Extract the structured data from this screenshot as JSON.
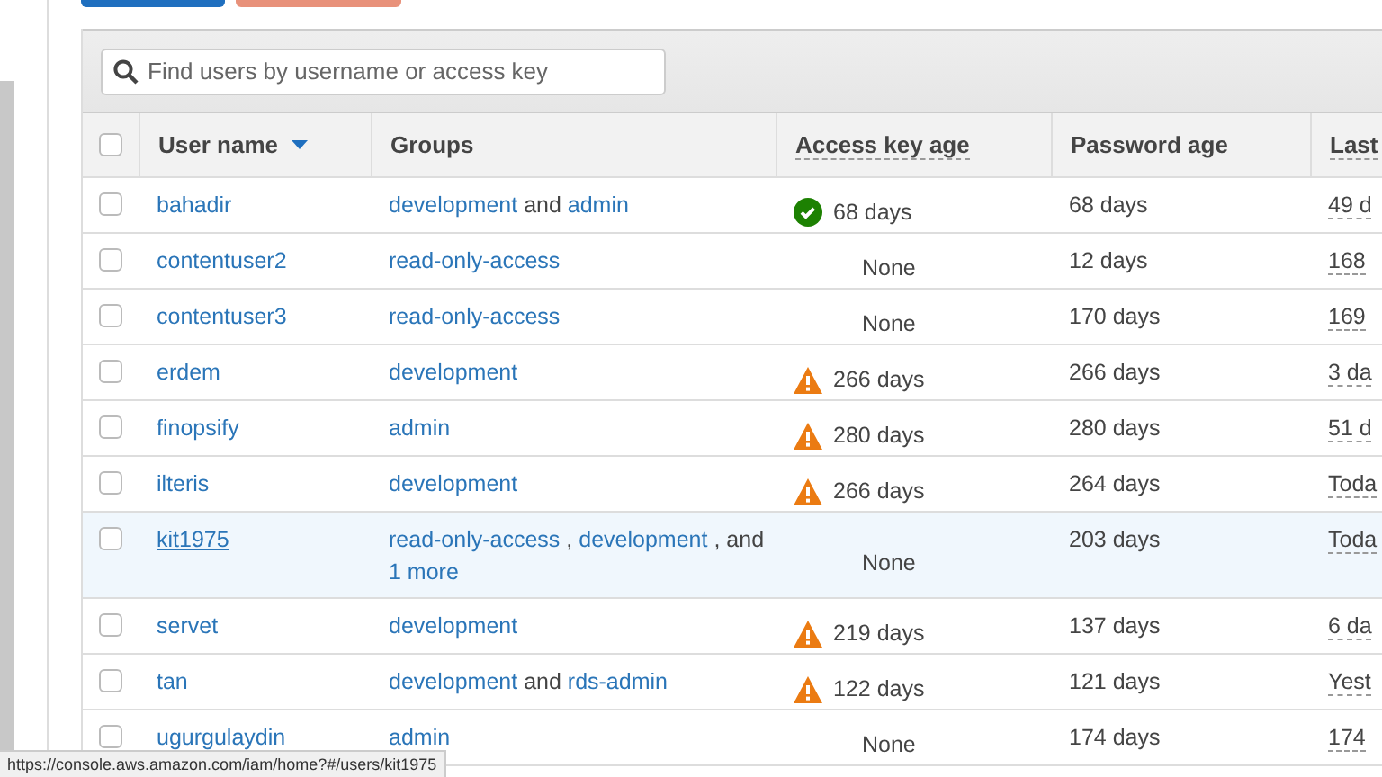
{
  "search": {
    "placeholder": "Find users by username or access key"
  },
  "table": {
    "select_all_checked": false,
    "columns": [
      {
        "label": "User name",
        "sorted": true,
        "dotted": false
      },
      {
        "label": "Groups",
        "sorted": false,
        "dotted": false
      },
      {
        "label": "Access key age",
        "sorted": false,
        "dotted": true
      },
      {
        "label": "Password age",
        "sorted": false,
        "dotted": false
      },
      {
        "label": "Last",
        "sorted": false,
        "dotted": true
      }
    ],
    "rows": [
      {
        "user": "bahadir",
        "hovered": false,
        "checked": false,
        "groups": [
          {
            "kind": "link",
            "text": "development"
          },
          {
            "kind": "text",
            "text": "and"
          },
          {
            "kind": "link",
            "text": "admin"
          }
        ],
        "kind": "ok",
        "key_age": "68 days",
        "password_age": "68 days",
        "last": "49 d"
      },
      {
        "user": "contentuser2",
        "hovered": false,
        "checked": false,
        "groups": [
          {
            "kind": "link",
            "text": "read-only-access"
          }
        ],
        "kind": "none",
        "key_age": "None",
        "password_age": "12 days",
        "last": "168"
      },
      {
        "user": "contentuser3",
        "hovered": false,
        "checked": false,
        "groups": [
          {
            "kind": "link",
            "text": "read-only-access"
          }
        ],
        "kind": "none",
        "key_age": "None",
        "password_age": "170 days",
        "last": "169"
      },
      {
        "user": "erdem",
        "hovered": false,
        "checked": false,
        "groups": [
          {
            "kind": "link",
            "text": "development"
          }
        ],
        "kind": "warning",
        "key_age": "266 days",
        "password_age": "266 days",
        "last": "3 da"
      },
      {
        "user": "finopsify",
        "hovered": false,
        "checked": false,
        "groups": [
          {
            "kind": "link",
            "text": "admin"
          }
        ],
        "kind": "warning",
        "key_age": "280 days",
        "password_age": "280 days",
        "last": "51 d"
      },
      {
        "user": "ilteris",
        "hovered": false,
        "checked": false,
        "groups": [
          {
            "kind": "link",
            "text": "development"
          }
        ],
        "kind": "warning",
        "key_age": "266 days",
        "password_age": "264 days",
        "last": "Toda"
      },
      {
        "user": "kit1975",
        "hovered": true,
        "checked": false,
        "groups": [
          {
            "kind": "link",
            "text": "read-only-access"
          },
          {
            "kind": "text",
            "text": ","
          },
          {
            "kind": "link",
            "text": "development"
          },
          {
            "kind": "text",
            "text": ","
          },
          {
            "kind": "text",
            "text": "and"
          },
          {
            "kind": "link",
            "text": "1 more"
          }
        ],
        "kind": "none",
        "key_age": "None",
        "password_age": "203 days",
        "last": "Toda"
      },
      {
        "user": "servet",
        "hovered": false,
        "checked": false,
        "groups": [
          {
            "kind": "link",
            "text": "development"
          }
        ],
        "kind": "warning",
        "key_age": "219 days",
        "password_age": "137 days",
        "last": "6 da"
      },
      {
        "user": "tan",
        "hovered": false,
        "checked": false,
        "groups": [
          {
            "kind": "link",
            "text": "development"
          },
          {
            "kind": "text",
            "text": "and"
          },
          {
            "kind": "link",
            "text": "rds-admin"
          }
        ],
        "kind": "warning",
        "key_age": "122 days",
        "password_age": "121 days",
        "last": "Yest"
      },
      {
        "user": "ugurgulaydin",
        "hovered": false,
        "checked": false,
        "groups": [
          {
            "kind": "link",
            "text": "admin"
          }
        ],
        "kind": "none",
        "key_age": "None",
        "password_age": "174 days",
        "last": "174"
      }
    ]
  },
  "status_bar": {
    "url": "https://console.aws.amazon.com/iam/home?#/users/kit1975"
  }
}
